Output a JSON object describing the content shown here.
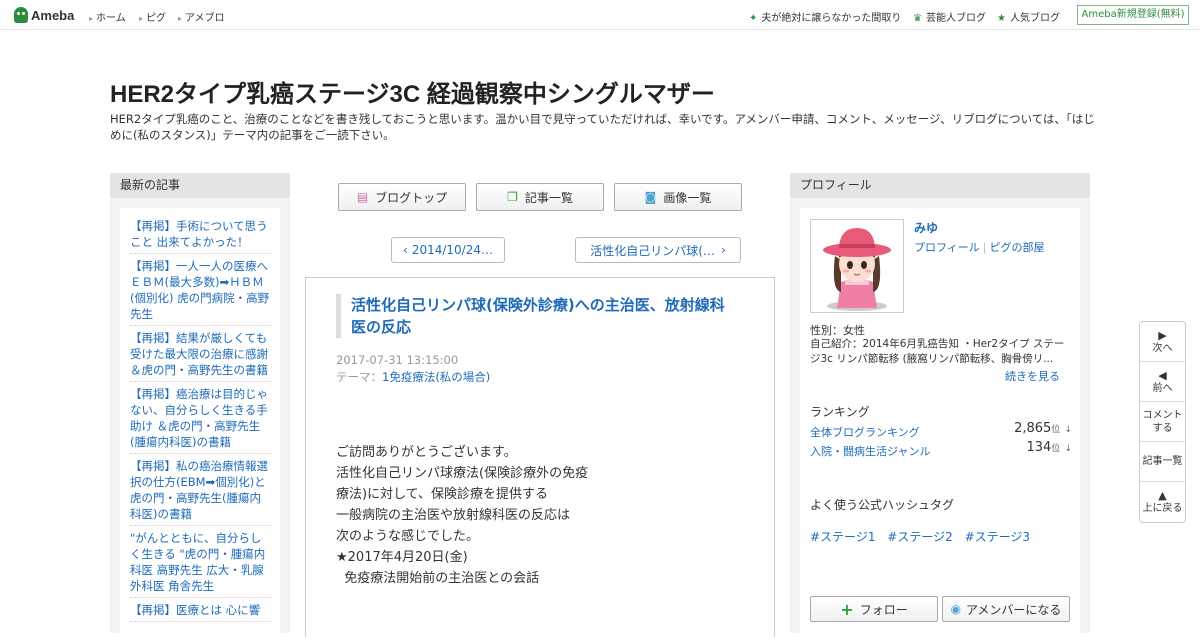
{
  "topbar": {
    "logo": "Ameba",
    "nav": [
      "ホーム",
      "ピグ",
      "アメブロ"
    ],
    "links": [
      {
        "label": "夫が絶対に譲らなかった間取り",
        "icon": "sparkle-icon"
      },
      {
        "label": "芸能人ブログ",
        "icon": "crown-icon"
      },
      {
        "label": "人気ブログ",
        "icon": "star-icon"
      }
    ],
    "signup": "Ameba新規登録(無料)"
  },
  "blog": {
    "title": "HER2タイプ乳癌ステージ3C 経過観察中シングルマザー",
    "description": "HER2タイプ乳癌のこと、治療のことなどを書き残しておこうと思います。温かい目で見守っていただければ、幸いです。アメンバー申請、コメント、メッセージ、リブログについては、「はじめに(私のスタンス)」テーマ内の記事をご一読下さい。"
  },
  "left": {
    "header": "最新の記事",
    "items": [
      "【再掲】手術について思うこと 出来てよかった！",
      "【再掲】一人一人の医療へ ＥＢＭ(最大多数)➡ＨＢＭ(個別化) 虎の門病院・高野先生",
      "【再掲】結果が厳しくても受けた最大限の治療に感謝 ＆虎の門・高野先生の書籍",
      "【再掲】癌治療は目的じゃない、自分らしく生きる手助け ＆虎の門・高野先生(腫瘍内科医)の書籍",
      "【再掲】私の癌治療情報選択の仕方(EBM➡個別化)と虎の門・高野先生(腫瘍内科医)の書籍",
      "\"がんとともに、自分らしく生きる \"虎の門・腫瘍内科医 高野先生 広大・乳腺外科医 角舎先生",
      "【再掲】医療とは 心に響"
    ]
  },
  "middle": {
    "buttons": {
      "top": "ブログトップ",
      "list": "記事一覧",
      "images": "画像一覧"
    },
    "pager": {
      "prev": "2014/10/24…",
      "next": "活性化自己リンパ球(…"
    },
    "article": {
      "title": "活性化自己リンパ球(保険外診療)への主治医、放射線科医の反応",
      "date": "2017-07-31 13:15:00",
      "theme_label": "テーマ：",
      "theme": "1免疫療法(私の場合)",
      "body": [
        "ご訪問ありがとうございます。",
        "",
        "活性化自己リンパ球療法(保険診療外の免疫",
        "療法)に対して、保険診療を提供する",
        "一般病院の主治医や放射線科医の反応は",
        "次のような感じでした。",
        "",
        "★2017年4月20日(金)",
        "  免疫療法開始前の主治医との会話"
      ]
    }
  },
  "right": {
    "header": "プロフィール",
    "name": "みゆ",
    "links": [
      "プロフィール",
      "ピグの部屋"
    ],
    "gender": "性別：女性",
    "intro": "自己紹介：2014年6月乳癌告知 ・Her2タイプ ステージ3c リンパ節転移 (腋窩リンパ節転移、胸骨傍リ...",
    "more": "続きを見る",
    "ranking_label": "ランキング",
    "rankings": [
      {
        "name": "全体ブログランキング",
        "value": "2,865",
        "unit": "位",
        "arrow": "↓"
      },
      {
        "name": "入院・闘病生活ジャンル",
        "value": "134",
        "unit": "位",
        "arrow": "↓"
      }
    ],
    "hashtag_label": "よく使う公式ハッシュタグ",
    "hashtags": [
      "#ステージ1",
      "#ステージ2",
      "#ステージ3"
    ],
    "follow": "フォロー",
    "member": "アメンバーになる"
  },
  "sidenav": {
    "next": "次へ",
    "prev": "前へ",
    "comment": "コメントする",
    "list": "記事一覧",
    "top": "上に戻る"
  },
  "colors": {
    "link": "#1f6bb8",
    "brand_green": "#2d8c3c"
  }
}
